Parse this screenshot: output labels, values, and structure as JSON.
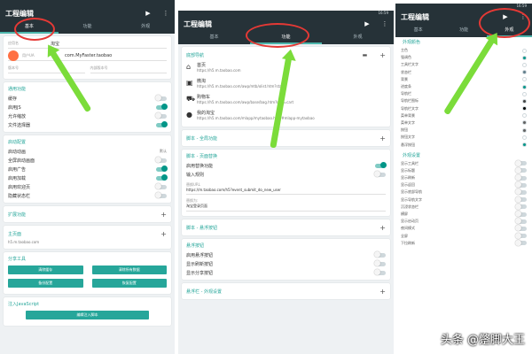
{
  "screens": [
    {
      "status_time": "",
      "title": "工程编辑",
      "tabs": [
        {
          "label": "基本",
          "active": true
        },
        {
          "label": "功能",
          "active": false
        },
        {
          "label": "外观",
          "active": false
        }
      ],
      "basic": {
        "name_label": "应用名",
        "name_value": "淘宝",
        "ua_label": "用户UA",
        "ua_value": "com.MyFaster.taobao",
        "version_label": "版本号",
        "version_value": "",
        "build_label": "内部版本号",
        "build_value": ""
      },
      "sections": [
        {
          "title": "通用功能",
          "rows": [
            {
              "label": "缓存",
              "on": false
            },
            {
              "label": "启用JS",
              "on": true
            },
            {
              "label": "允许缩放",
              "on": false
            },
            {
              "label": "文件选择器",
              "on": true
            }
          ]
        },
        {
          "title": "启动配置",
          "value_row": {
            "label": "启动动画",
            "value": "默认"
          },
          "rows": [
            {
              "label": "全屏启动画面",
              "on": false
            },
            {
              "label": "启用广告",
              "on": true
            },
            {
              "label": "启用加载",
              "on": true
            },
            {
              "label": "启用欢迎页",
              "on": false
            },
            {
              "label": "隐藏状态栏",
              "on": false
            }
          ]
        }
      ],
      "plugins_title": "扩展功能",
      "homepage_title": "主页面",
      "homepage_url": "h5.m.taobao.com",
      "group_title": "分享工具",
      "buttons": [
        "清除缓存",
        "清除所有数据",
        "备份配置",
        "恢复配置"
      ],
      "js_title": "注入JavaScript",
      "js_button": "编辑注入脚本"
    },
    {
      "status_time": "16:59",
      "title": "工程编辑",
      "tabs": [
        {
          "label": "基本",
          "active": false
        },
        {
          "label": "功能",
          "active": true
        },
        {
          "label": "外观",
          "active": false
        }
      ],
      "menu_title": "底部导航",
      "menu_items": [
        {
          "icon": "home-icon",
          "title": "首页",
          "url": "https://h5.m.taobao.com"
        },
        {
          "icon": "bus-icon",
          "title": "微淘",
          "url": "https://h5.m.taobao.com/awp/mtb/olist.htm?sta=5"
        },
        {
          "icon": "cart-icon",
          "title": "购物车",
          "url": "https://h5.m.taobao.com/awp/base/bag.htm?nda=cart"
        },
        {
          "icon": "person-icon",
          "title": "我的淘宝",
          "url": "https://h5.m.taobao.com/mlapp/mytaobao.html#mlapp-mytaobao"
        }
      ],
      "script_title": "脚本 - 全局功能",
      "replace_title": "脚本 - 页面替换",
      "replace_rows": [
        {
          "label": "启用替换功能",
          "on": true
        }
      ],
      "replace_sub": "输入规则",
      "replace_url_label": "替换URL",
      "replace_url": "https://m.taobao.com/h5?event_submit_do_new_user",
      "replace_text_label": "替换为:",
      "replace_text": "淘宝登录页面",
      "float_title": "脚本 - 悬浮按钮",
      "float_sub": "悬浮按钮",
      "float_rows": [
        {
          "label": "启用悬浮按钮",
          "on": false
        },
        {
          "label": "显示刷新按钮",
          "on": false
        },
        {
          "label": "显示分享按钮",
          "on": false
        }
      ],
      "bottom_title": "悬浮栏 - 外观设置"
    },
    {
      "status_time": "16:59",
      "title": "工程编辑",
      "tabs": [
        {
          "label": "基本",
          "active": false
        },
        {
          "label": "功能",
          "active": false
        },
        {
          "label": "外观",
          "active": true
        }
      ],
      "colors_title": "外观颜色",
      "colors": [
        {
          "label": "主色",
          "color": "#ffffff"
        },
        {
          "label": "强调色",
          "color": "#009688"
        },
        {
          "label": "工具栏文字",
          "color": "#ffffff"
        },
        {
          "label": "状态栏",
          "color": "#607d8b"
        },
        {
          "label": "背景",
          "color": "#ffffff"
        },
        {
          "label": "进度条",
          "color": "#009688"
        },
        {
          "label": "导航栏",
          "color": "#ffffff"
        },
        {
          "label": "导航栏图标",
          "color": "#424242"
        },
        {
          "label": "导航栏文字",
          "color": "#000000"
        },
        {
          "label": "菜单背景",
          "color": "#ffffff"
        },
        {
          "label": "菜单文字",
          "color": "#616161"
        },
        {
          "label": "按钮",
          "color": "#616161"
        },
        {
          "label": "按钮文字",
          "color": "#ffffff"
        },
        {
          "label": "悬浮按钮",
          "color": "#009688"
        }
      ],
      "options_title": "外观设置",
      "options": [
        {
          "label": "显示工具栏",
          "on": false
        },
        {
          "label": "显示标题",
          "on": false
        },
        {
          "label": "显示刷新",
          "on": false
        },
        {
          "label": "显示返回",
          "on": false
        },
        {
          "label": "显示底部导航",
          "on": false
        },
        {
          "label": "显示导航文字",
          "on": false
        },
        {
          "label": "沉浸状态栏",
          "on": false
        },
        {
          "label": "横屏",
          "on": false
        },
        {
          "label": "显示启动页",
          "on": false
        },
        {
          "label": "夜间模式",
          "on": false
        },
        {
          "label": "全屏",
          "on": false
        },
        {
          "label": "下拉刷新",
          "on": false
        }
      ]
    }
  ],
  "watermark": "头条 @蹩脚大王",
  "colors": {
    "appbar": "#263238",
    "accent": "#26a69a",
    "highlight_circle": "#e53935",
    "arrow": "#7bdc3a"
  }
}
